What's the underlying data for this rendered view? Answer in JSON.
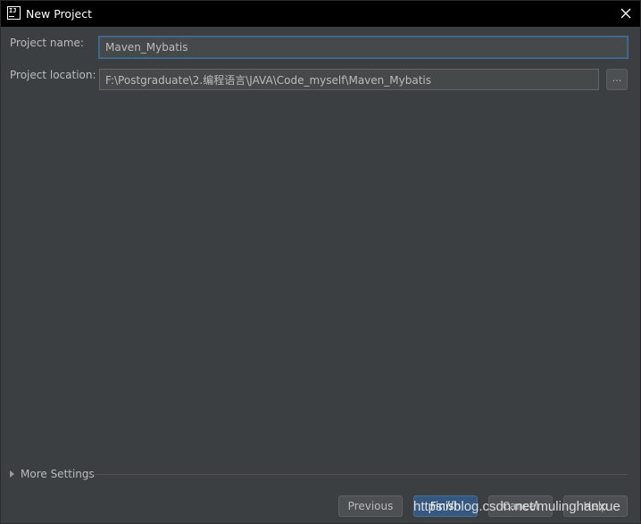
{
  "window": {
    "title": "New Project",
    "app_icon": "intellij-idea-icon",
    "app_icon_text": "IJ"
  },
  "form": {
    "name_label": "Project name:",
    "name_value": "Maven_Mybatis",
    "location_label": "Project location:",
    "location_value": "F:\\Postgraduate\\2.编程语言\\JAVA\\Code_myself\\Maven_Mybatis",
    "browse_label": "..."
  },
  "more_settings": {
    "label": "More Settings"
  },
  "buttons": {
    "previous": "Previous",
    "finish": "Finish",
    "cancel": "Cancel",
    "help": "Help"
  },
  "watermark": "https://blog.csdn.net/mulinghanxue",
  "colors": {
    "background": "#3c3f41",
    "titlebar": "#000000",
    "input_background": "#45494a",
    "focus_border": "#466d94",
    "primary_button": "#365880",
    "text": "#bbbbbb"
  }
}
